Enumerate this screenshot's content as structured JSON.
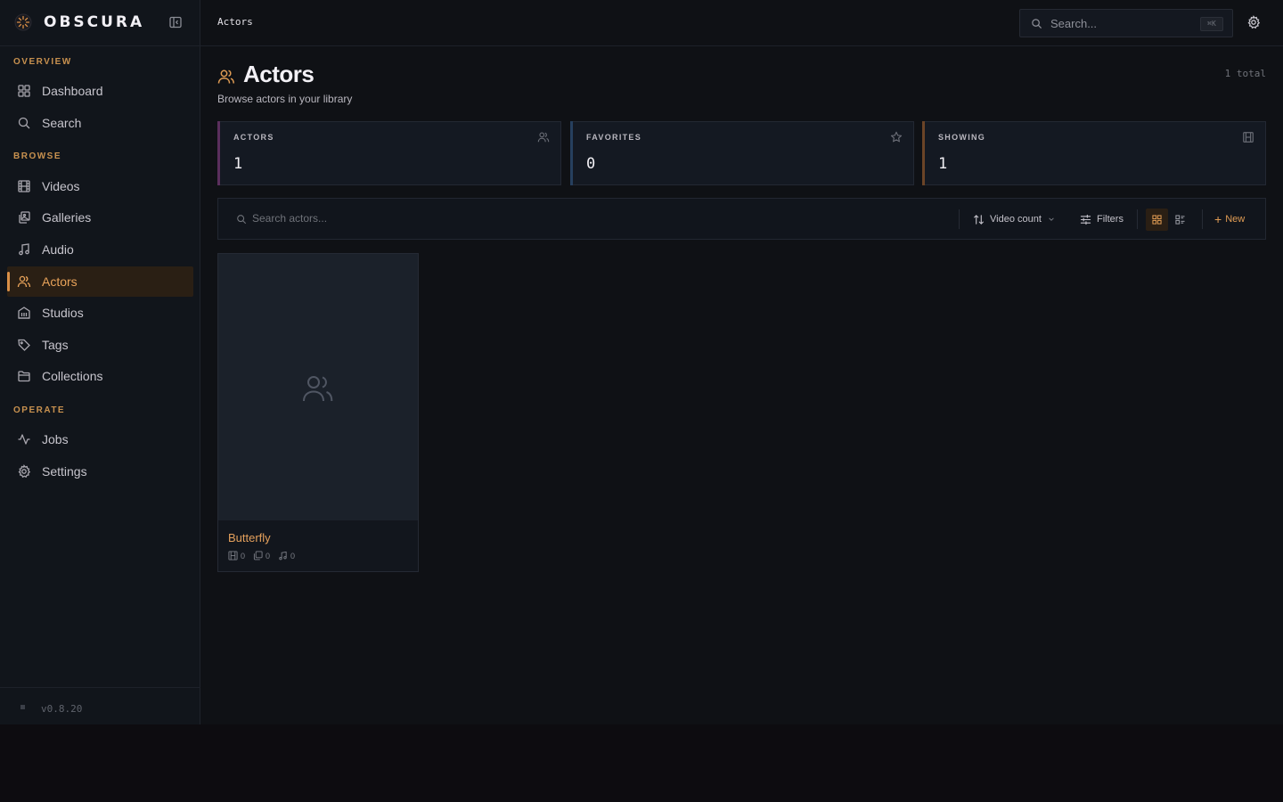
{
  "app": {
    "name": "OBSCURA",
    "version": "v0.8.20"
  },
  "sidebar": {
    "sections": [
      {
        "label": "OVERVIEW",
        "items": [
          {
            "label": "Dashboard",
            "icon": "dashboard-icon"
          },
          {
            "label": "Search",
            "icon": "search-icon"
          }
        ]
      },
      {
        "label": "BROWSE",
        "items": [
          {
            "label": "Videos",
            "icon": "film-icon"
          },
          {
            "label": "Galleries",
            "icon": "gallery-icon"
          },
          {
            "label": "Audio",
            "icon": "music-icon"
          },
          {
            "label": "Actors",
            "icon": "users-icon",
            "active": true
          },
          {
            "label": "Studios",
            "icon": "building-icon"
          },
          {
            "label": "Tags",
            "icon": "tag-icon"
          },
          {
            "label": "Collections",
            "icon": "folder-icon"
          }
        ]
      },
      {
        "label": "OPERATE",
        "items": [
          {
            "label": "Jobs",
            "icon": "activity-icon"
          },
          {
            "label": "Settings",
            "icon": "gear-icon"
          }
        ]
      }
    ]
  },
  "topbar": {
    "breadcrumb": "Actors",
    "search_placeholder": "Search...",
    "shortcut": "⌘K"
  },
  "header": {
    "title": "Actors",
    "subtitle": "Browse actors in your library",
    "total": "1 total"
  },
  "stats": [
    {
      "label": "ACTORS",
      "value": "1",
      "icon": "users-icon",
      "accent": "#5a2f5c"
    },
    {
      "label": "FAVORITES",
      "value": "0",
      "icon": "star-icon",
      "accent": "#263f5e"
    },
    {
      "label": "SHOWING",
      "value": "1",
      "icon": "film-icon",
      "accent": "#6b4427"
    }
  ],
  "toolbar": {
    "search_placeholder": "Search actors...",
    "sort_label": "Video count",
    "filters_label": "Filters",
    "new_label": "New",
    "view_mode": "grid"
  },
  "actors": [
    {
      "name": "Butterfly",
      "videos": "0",
      "galleries": "0",
      "audio": "0"
    }
  ],
  "colors": {
    "accent": "#e09c54",
    "background": "#0f1115",
    "sidebar": "#11151b"
  }
}
